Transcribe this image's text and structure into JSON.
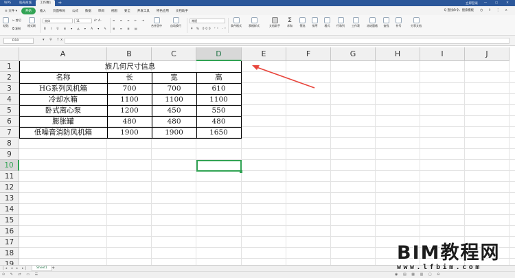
{
  "titlebar": {
    "tabs": [
      {
        "label": "WPS"
      },
      {
        "label": "稻壳商城"
      },
      {
        "label": "工作簿1"
      }
    ],
    "new_tab": "+",
    "right": {
      "sign_in": "立即登录",
      "min": "—",
      "max": "▢",
      "close": "✕"
    }
  },
  "menubar": {
    "file": "≡ 文件 ▾",
    "items": [
      "开始",
      "插入",
      "页面布局",
      "公式",
      "数据",
      "审阅",
      "视图",
      "安全",
      "开发工具",
      "特色应用",
      "文档助手"
    ],
    "active_index": 0,
    "search": "Q 查找命令、搜索模板",
    "right_icons": "◷ ⇪ ⋮ ∧"
  },
  "ribbon": {
    "paste": "粘贴",
    "cut": "剪切",
    "copy": "复制",
    "format_painter": "格式刷",
    "font_name": "宋体",
    "font_size": "11",
    "merge": "合并居中",
    "wrap": "自动换行",
    "number_format": "常规",
    "cond_format": "条件格式",
    "table_style": "表格样式",
    "doc_helper": "文档助手",
    "sum": "求和",
    "filter": "筛选",
    "sort": "排序",
    "format": "格式",
    "row_col": "行和列",
    "worksheet": "工作表",
    "freeze": "冻结窗格",
    "find": "查找",
    "symbol": "符号",
    "share": "分享文档"
  },
  "formula_bar": {
    "name_box": "D10",
    "icons": "▾ ⚲ fx",
    "formula": ""
  },
  "sheet": {
    "columns": [
      "A",
      "B",
      "C",
      "D",
      "E",
      "F",
      "G",
      "H",
      "I",
      "J"
    ],
    "rows": [
      "1",
      "2",
      "3",
      "4",
      "5",
      "6",
      "7",
      "8",
      "9",
      "10",
      "11",
      "12",
      "13",
      "14",
      "15",
      "16",
      "17",
      "18",
      "19"
    ],
    "active_column": "D",
    "active_row": "10",
    "title": "族几何尺寸信息",
    "headers": [
      "名称",
      "长",
      "宽",
      "高"
    ],
    "data": [
      [
        "HG系列风机箱",
        "700",
        "700",
        "610"
      ],
      [
        "冷却水箱",
        "1100",
        "1100",
        "1100"
      ],
      [
        "卧式离心泵",
        "1200",
        "450",
        "550"
      ],
      [
        "膨胀罐",
        "480",
        "480",
        "480"
      ],
      [
        "低噪音消防风机箱",
        "1900",
        "1900",
        "1650"
      ]
    ]
  },
  "sheetbar": {
    "nav": "|◂ ◂ ▸ ▸|",
    "tab": "Sheet1",
    "add": "+"
  },
  "statusbar": {
    "left_icons": "⊙ ✎ ⇄ ▭ ☰",
    "right_icons": "◉ ▤ ▦ ▥ ▢ ⊖"
  },
  "watermark": {
    "main": "BIM教程网",
    "url": "www.lfbim.com"
  },
  "colors": {
    "accent": "#31a354",
    "title_bar": "#2b579a",
    "arrow": "#e8453c"
  }
}
